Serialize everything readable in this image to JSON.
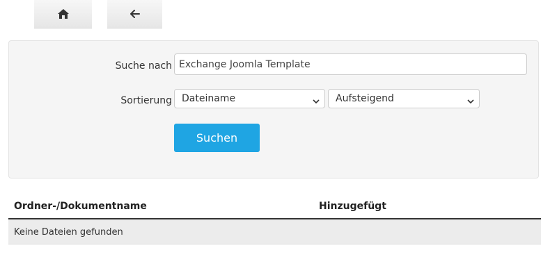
{
  "toolbar": {
    "home_icon": "home-icon",
    "back_icon": "arrow-left-icon"
  },
  "search": {
    "label": "Suche nach",
    "value": "Exchange Joomla Template"
  },
  "sort": {
    "label": "Sortierung",
    "field_value": "Dateiname",
    "direction_value": "Aufsteigend"
  },
  "submit": {
    "label": "Suchen",
    "color": "#1fa5e3"
  },
  "table": {
    "columns": [
      "Ordner-/Dokumentname",
      "Hinzugefügt"
    ],
    "empty_message": "Keine Dateien gefunden"
  }
}
